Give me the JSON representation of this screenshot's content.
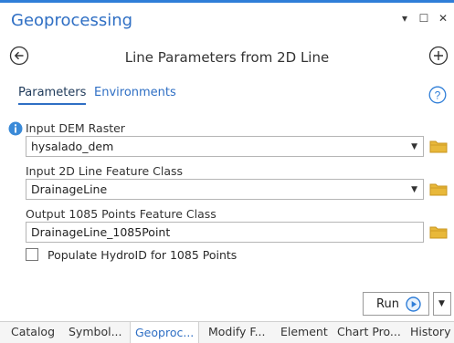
{
  "window": {
    "title": "Geoprocessing",
    "controls": {
      "menu": "▾",
      "restore": "☐",
      "close": "✕"
    }
  },
  "tool": {
    "title": "Line Parameters from 2D Line"
  },
  "tabs": [
    {
      "label": "Parameters",
      "active": true
    },
    {
      "label": "Environments",
      "active": false
    }
  ],
  "params": {
    "dem_label": "Input DEM Raster",
    "dem_value": "hysalado_dem",
    "line_label": "Input 2D Line Feature Class",
    "line_value": "DrainageLine",
    "output_label": "Output 1085 Points Feature Class",
    "output_value": "DrainageLine_1085Point",
    "populate_label": "Populate HydroID for 1085 Points",
    "populate_checked": false
  },
  "run": {
    "label": "Run"
  },
  "bottom_tabs": [
    "Catalog",
    "Symbol...",
    "Geoproc...",
    "Modify F...",
    "Element",
    "Chart Pro...",
    "History"
  ],
  "colors": {
    "accent": "#2f6fc4",
    "folder": "#e8b83a",
    "info": "#3a8ad8"
  }
}
